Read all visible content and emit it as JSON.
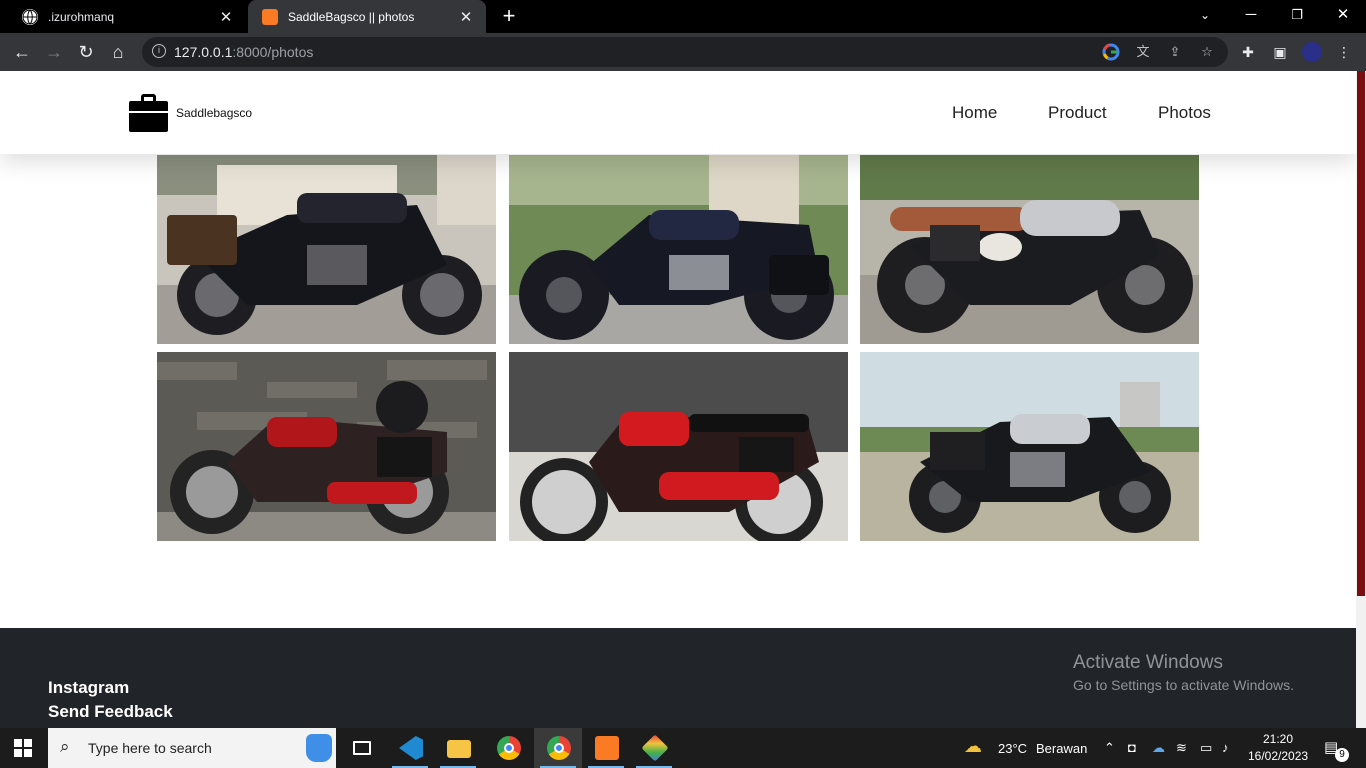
{
  "browser": {
    "tabs": [
      {
        "title": ".izurohmanq",
        "active": false
      },
      {
        "title": "SaddleBagsco || photos",
        "active": true
      }
    ],
    "url": {
      "host": "127.0.0.1",
      "path": ":8000/photos"
    }
  },
  "site": {
    "brand": "Saddlebagsco",
    "nav": [
      "Home",
      "Product",
      "Photos"
    ],
    "photos": [
      {
        "alt": "black cafe racer motorcycle with leather saddlebag"
      },
      {
        "alt": "black cruiser motorcycle with saddlebag"
      },
      {
        "alt": "silver scrambler motorcycle number 175"
      },
      {
        "alt": "red Honda classic motorcycle with helmet"
      },
      {
        "alt": "red vintage Honda motorcycle with saddlebag"
      },
      {
        "alt": "black and silver bobber motorcycle"
      }
    ],
    "footer": {
      "links": [
        "Instagram",
        "Send Feedback"
      ]
    },
    "watermark": {
      "title": "Activate Windows",
      "subtitle": "Go to Settings to activate Windows."
    }
  },
  "taskbar": {
    "search_placeholder": "Type here to search",
    "weather": {
      "temp": "23°C",
      "condition": "Berawan"
    },
    "time": "21:20",
    "date": "16/02/2023",
    "notification_count": "9"
  }
}
